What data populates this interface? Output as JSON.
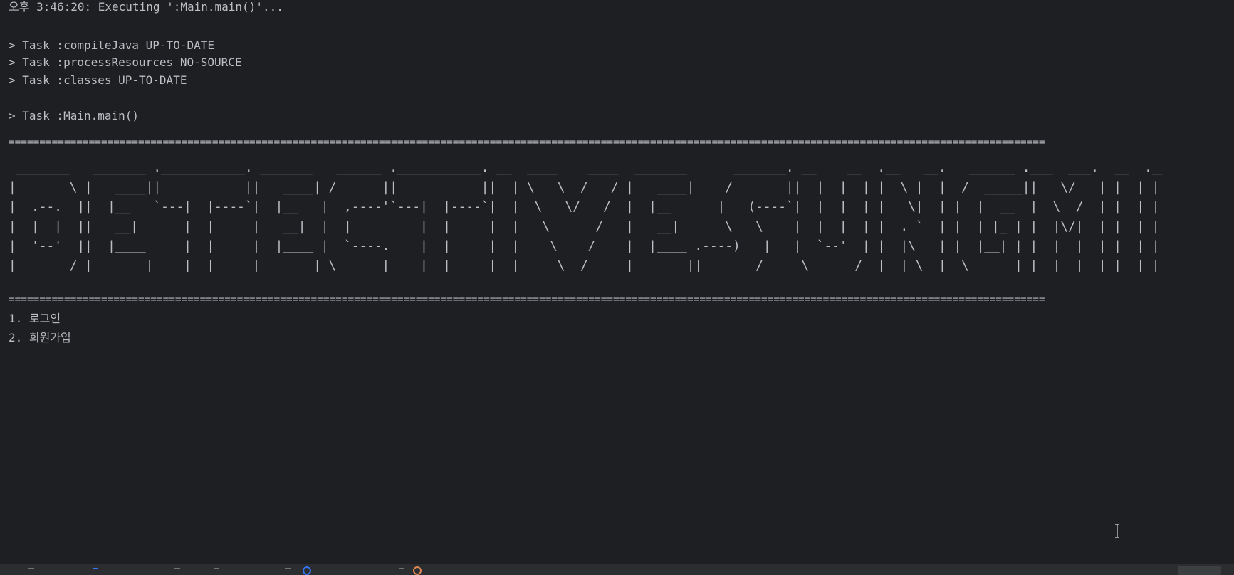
{
  "console": {
    "header_line": "오후 3:46:20: Executing ':Main.main()'...",
    "tasks": [
      "> Task :compileJava UP-TO-DATE",
      "> Task :processResources NO-SOURCE",
      "> Task :classes UP-TO-DATE"
    ],
    "main_task": "> Task :Main.main()",
    "separator_top": "========================================================================================================================================================================",
    "banner": [
      " _______   _______ .___________. _______   ______ .___________. __  ____    ____  _______      _______. __    __  .__   __.   ______ .___  ___.  __  .__   __. ",
      "|       \\ |   ____||           ||   ____| /      ||           ||  | \\   \\  /   / |   ____|    /       ||  |  |  | |  \\ |  |  /  _____||   \\/   | |  | |  \\ |  | ",
      "|  .--.  ||  |__   `---|  |----`|  |__   |  ,----'`---|  |----`|  |  \\   \\/   /  |  |__      |   (----`|  |  |  | |   \\|  | |  |  __  |  \\  /  | |  | |   \\|  | ",
      "|  |  |  ||   __|      |  |     |   __|  |  |         |  |     |  |   \\      /   |   __|      \\   \\    |  |  |  | |  . `  | |  | |_ | |  |\\/|  | |  | |  . `  | ",
      "|  '--'  ||  |____     |  |     |  |____ |  `----.    |  |     |  |    \\    /    |  |____ .----)   |   |  `--'  | |  |\\   | |  |__| | |  |  |  | |  | |  |\\   | ",
      "|_______/ |_______|    |__|     |_______| \\______|    |__|     |__|     \\__/     |_______||_______/     \\______/  |__| \\__|  \\______| |__|  |__| |__| |__| \\__| "
    ],
    "separator_bottom": "========================================================================================================================================================================",
    "menu": [
      "1. 로그인",
      "2. 회원가입"
    ]
  },
  "icons": {
    "cursor": "text-cursor-icon",
    "status_blue": "info-circle-icon",
    "status_orange": "warning-circle-icon"
  },
  "colors": {
    "background": "#1e1f22",
    "text": "#bcbec4",
    "status_bar": "#2b2d30",
    "accent_blue": "#3574f0",
    "accent_orange": "#e08855"
  }
}
